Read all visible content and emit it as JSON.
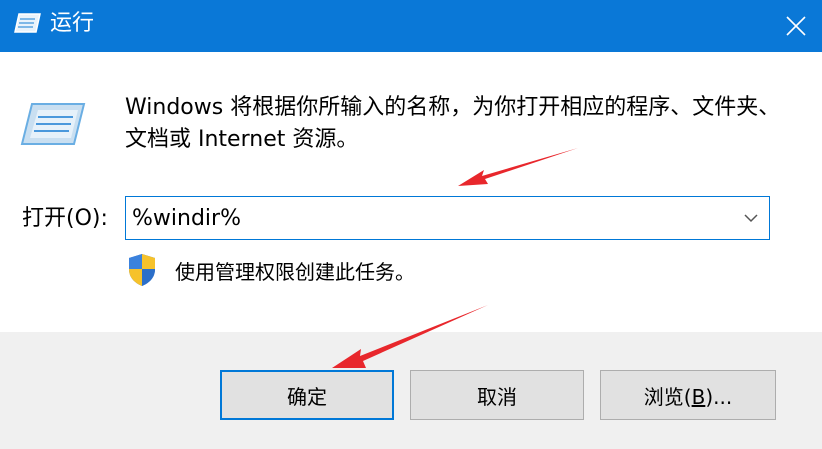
{
  "window": {
    "title": "运行"
  },
  "dialog": {
    "description": "Windows 将根据你所输入的名称，为你打开相应的程序、文件夹、文档或 Internet 资源。",
    "open_label": "打开(O):",
    "input_value": "%windir%",
    "admin_note": "使用管理权限创建此任务。"
  },
  "buttons": {
    "ok": "确定",
    "cancel": "取消",
    "browse_prefix": "浏览(",
    "browse_key": "B",
    "browse_suffix": ")..."
  },
  "icons": [
    "run-icon",
    "close-icon",
    "chevron-down-icon",
    "shield-icon"
  ],
  "colors": {
    "titlebar": "#0a78d7",
    "focus_border": "#0078d7",
    "annotation_arrow": "#e8272c"
  }
}
